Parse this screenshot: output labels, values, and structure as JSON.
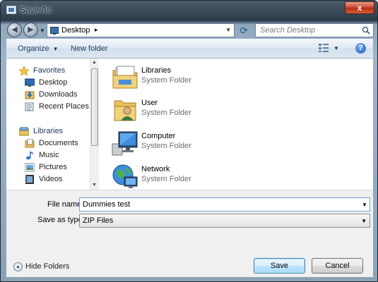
{
  "window": {
    "title": "Save As",
    "close_label": "x"
  },
  "navigation": {
    "back_icon": "back-arrow-icon",
    "forward_icon": "forward-arrow-icon",
    "address": {
      "location": "Desktop",
      "separator": "▸"
    },
    "refresh_icon": "refresh-icon",
    "search": {
      "placeholder": "Search Desktop"
    }
  },
  "toolbar": {
    "organize_label": "Organize",
    "new_folder_label": "New folder",
    "help_label": "?"
  },
  "sidebar": {
    "groups": [
      {
        "label": "Favorites",
        "icon": "star-icon",
        "items": [
          {
            "label": "Desktop",
            "icon": "desktop-icon"
          },
          {
            "label": "Downloads",
            "icon": "downloads-icon"
          },
          {
            "label": "Recent Places",
            "icon": "recent-places-icon"
          }
        ]
      },
      {
        "label": "Libraries",
        "icon": "libraries-icon",
        "items": [
          {
            "label": "Documents",
            "icon": "documents-icon"
          },
          {
            "label": "Music",
            "icon": "music-icon"
          },
          {
            "label": "Pictures",
            "icon": "pictures-icon"
          },
          {
            "label": "Videos",
            "icon": "videos-icon"
          }
        ]
      }
    ]
  },
  "files": [
    {
      "name": "Libraries",
      "type": "System Folder",
      "icon": "libraries-folder-icon"
    },
    {
      "name": "User",
      "type": "System Folder",
      "icon": "user-folder-icon"
    },
    {
      "name": "Computer",
      "type": "System Folder",
      "icon": "computer-icon"
    },
    {
      "name": "Network",
      "type": "System Folder",
      "icon": "network-icon"
    }
  ],
  "form": {
    "file_name_label": "File name:",
    "file_name_value": "Dummies test",
    "save_as_type_label": "Save as type:",
    "save_as_type_value": "ZIP Files"
  },
  "footer": {
    "hide_folders_label": "Hide Folders",
    "save_label": "Save",
    "cancel_label": "Cancel"
  },
  "colors": {
    "title_bar": "#2c3b48",
    "toolbar_text": "#1e395b",
    "close_button": "#c7432a",
    "default_button_border": "#3c7fb1"
  }
}
